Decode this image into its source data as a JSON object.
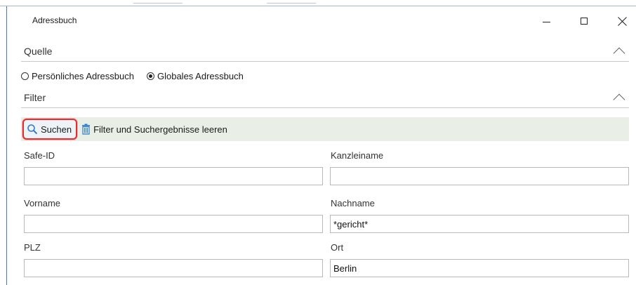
{
  "window": {
    "title": "Adressbuch",
    "controls": {
      "minimize_icon": "minimize-icon",
      "maximize_icon": "maximize-icon",
      "close_icon": "close-icon"
    }
  },
  "source_section": {
    "title": "Quelle",
    "options": [
      {
        "label": "Persönliches Adressbuch",
        "checked": false
      },
      {
        "label": "Globales Adressbuch",
        "checked": true
      }
    ]
  },
  "filter_section": {
    "title": "Filter",
    "toolbar": {
      "search_label": "Suchen",
      "search_icon": "magnifier-icon",
      "clear_label": "Filter und Suchergebnisse leeren",
      "clear_icon": "trash-icon"
    },
    "fields": {
      "safe_id": {
        "label": "Safe-ID",
        "value": ""
      },
      "kanzleiname": {
        "label": "Kanzleiname",
        "value": ""
      },
      "vorname": {
        "label": "Vorname",
        "value": ""
      },
      "nachname": {
        "label": "Nachname",
        "value": "*gericht*"
      },
      "plz": {
        "label": "PLZ",
        "value": ""
      },
      "ort": {
        "label": "Ort",
        "value": "Berlin"
      }
    }
  },
  "colors": {
    "toolbar_bg": "#e9efe6",
    "highlight_border": "#e03030",
    "icon_blue": "#2b7bd0",
    "window_border": "#4a78b0"
  }
}
